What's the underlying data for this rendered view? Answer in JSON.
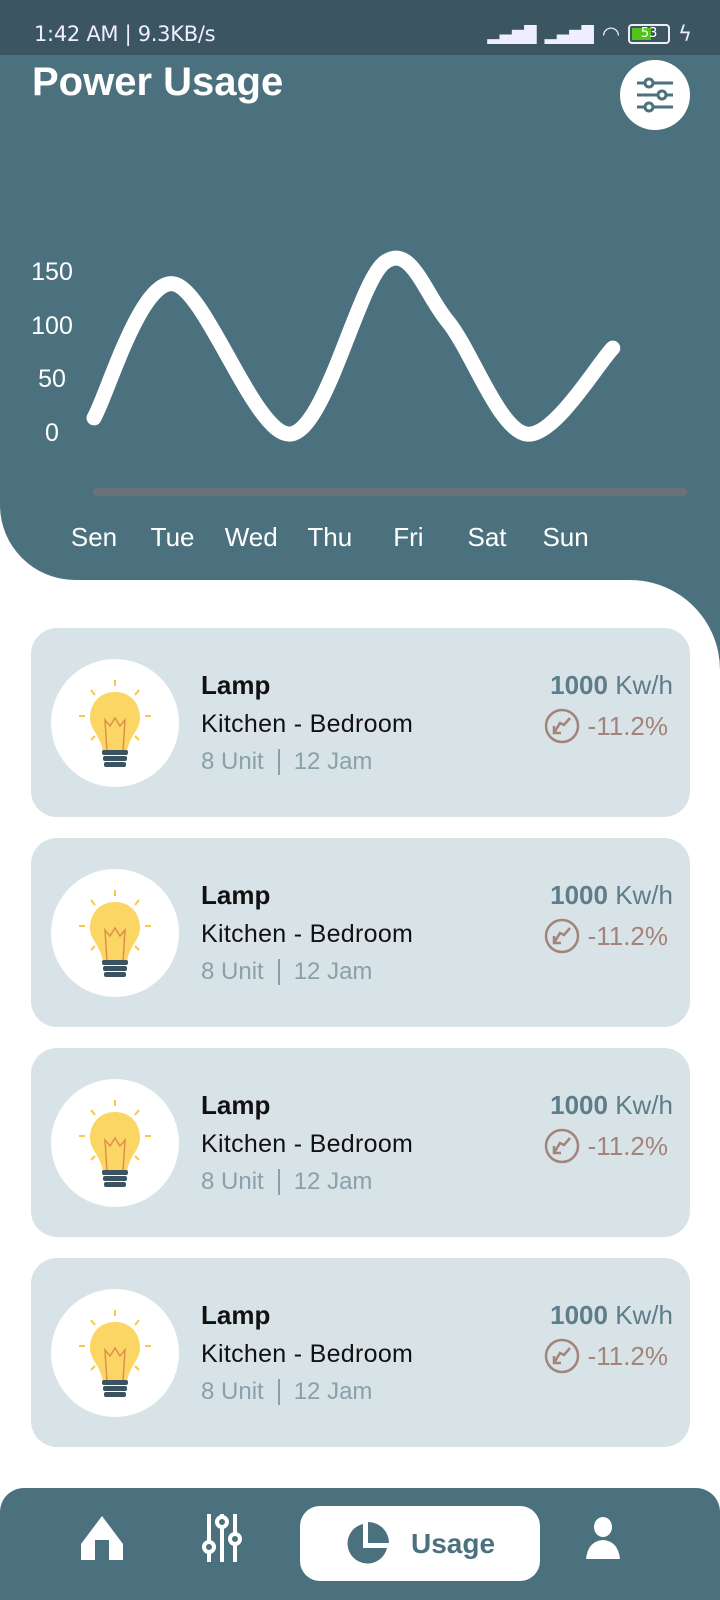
{
  "status_bar": {
    "time": "1:42 AM | 9.3KB/s",
    "battery": "53"
  },
  "header": {
    "title": "Power Usage",
    "filter_icon": "sliders-icon"
  },
  "colors": {
    "header": "#4b717e",
    "card": "#d8e3e7",
    "accent_down": "#a3837a",
    "power": "#5e7d8a"
  },
  "chart_data": {
    "type": "line",
    "categories": [
      "Sen",
      "Tue",
      "Wed",
      "Thu",
      "Fri",
      "Sat",
      "Sun"
    ],
    "x": [
      0,
      1,
      2.5,
      3.7,
      4.5,
      5.5,
      6.6
    ],
    "y": [
      15,
      140,
      0,
      160,
      105,
      0,
      80
    ],
    "yticks": [
      150,
      100,
      50,
      0
    ],
    "ylim": [
      0,
      150
    ],
    "grid": false,
    "smooth": true,
    "line_color": "#ffffff"
  },
  "devices": [
    {
      "name": "Lamp",
      "room": "Kitchen - Bedroom",
      "units": "8 Unit",
      "hours": "12 Jam",
      "power": "1000",
      "unit": "Kw/h",
      "change": "-11.2%"
    },
    {
      "name": "Lamp",
      "room": "Kitchen - Bedroom",
      "units": "8 Unit",
      "hours": "12 Jam",
      "power": "1000",
      "unit": "Kw/h",
      "change": "-11.2%"
    },
    {
      "name": "Lamp",
      "room": "Kitchen - Bedroom",
      "units": "8 Unit",
      "hours": "12 Jam",
      "power": "1000",
      "unit": "Kw/h",
      "change": "-11.2%"
    },
    {
      "name": "Lamp",
      "room": "Kitchen - Bedroom",
      "units": "8 Unit",
      "hours": "12 Jam",
      "power": "1000",
      "unit": "Kw/h",
      "change": "-11.2%"
    }
  ],
  "nav": {
    "items": [
      {
        "icon": "home-icon"
      },
      {
        "icon": "sliders-icon"
      },
      {
        "icon": "pie-chart-icon",
        "label": "Usage",
        "active": true
      },
      {
        "icon": "user-icon"
      }
    ]
  }
}
